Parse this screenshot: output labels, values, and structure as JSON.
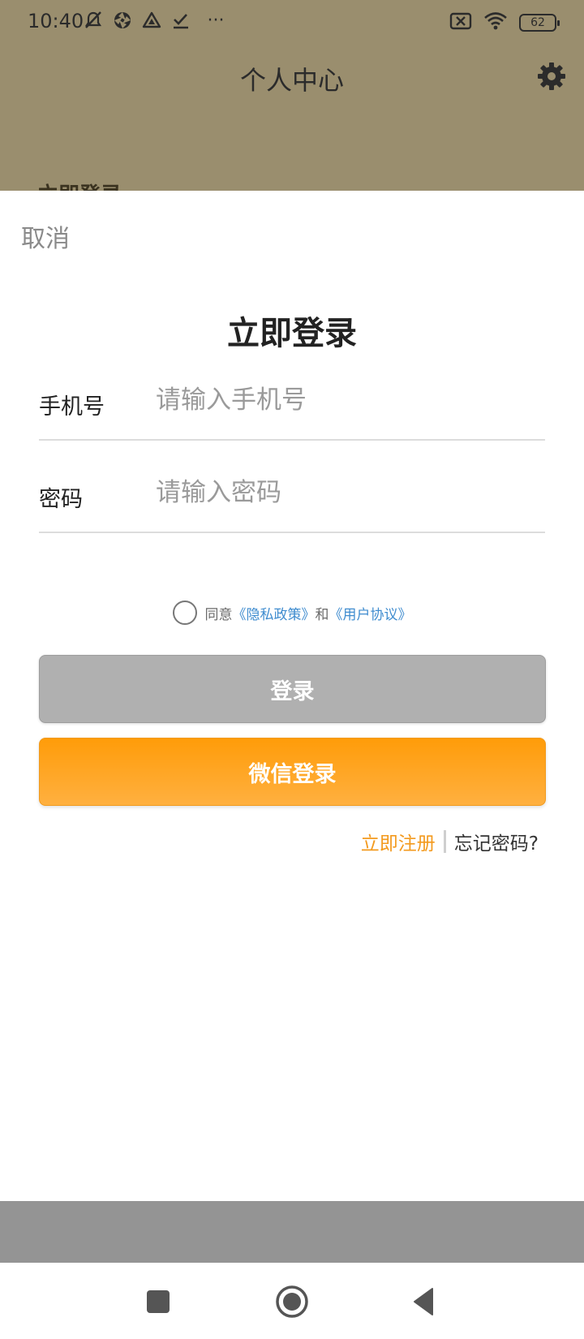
{
  "status_bar": {
    "time": "10:40",
    "more": "···",
    "battery": "62",
    "icons": [
      "mute-icon",
      "aperture-icon",
      "drive-icon",
      "check-icon",
      "sim-off-icon",
      "wifi-icon",
      "battery-icon"
    ]
  },
  "background_page": {
    "title": "个人中心",
    "peek_text": "立即登录",
    "settings_icon": "gear-icon",
    "overlay_color": "#9a8e6e"
  },
  "sheet": {
    "cancel": "取消",
    "title": "立即登录",
    "phone": {
      "label": "手机号",
      "placeholder": "请输入手机号",
      "value": ""
    },
    "password": {
      "label": "密码",
      "placeholder": "请输入密码",
      "value": ""
    },
    "agreement": {
      "checked": false,
      "prefix": "同意",
      "privacy": "《隐私政策》",
      "and": "和",
      "terms": "《用户协议》"
    },
    "login_button": "登录",
    "wechat_button": "微信登录",
    "register": "立即注册",
    "forgot": "忘记密码?"
  },
  "colors": {
    "accent_orange": "#ff9c09",
    "link_blue": "#3f8ccf",
    "disabled_gray": "#b0b0b0"
  },
  "nav_bar": {
    "icons": [
      "recents-square-icon",
      "home-circle-icon",
      "back-triangle-icon"
    ]
  }
}
